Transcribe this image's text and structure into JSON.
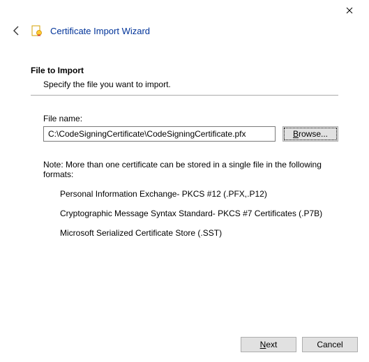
{
  "window": {
    "title": "Certificate Import Wizard"
  },
  "section": {
    "heading": "File to Import",
    "subheading": "Specify the file you want to import."
  },
  "file": {
    "label": "File name:",
    "value": "C:\\CodeSigningCertificate\\CodeSigningCertificate.pfx",
    "browse_prefix": "B",
    "browse_rest": "rowse..."
  },
  "note": {
    "intro": "Note:  More than one certificate can be stored in a single file in the following formats:",
    "items": [
      "Personal Information Exchange- PKCS #12 (.PFX,.P12)",
      "Cryptographic Message Syntax Standard- PKCS #7 Certificates (.P7B)",
      "Microsoft Serialized Certificate Store (.SST)"
    ]
  },
  "footer": {
    "next_prefix": "N",
    "next_rest": "ext",
    "cancel": "Cancel"
  }
}
